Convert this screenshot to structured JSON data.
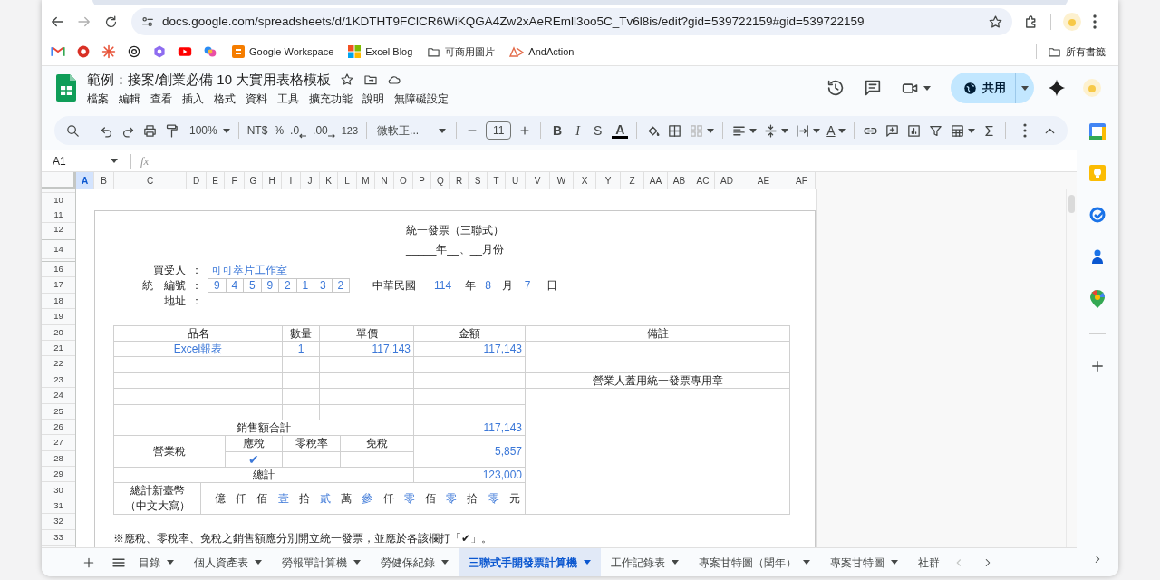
{
  "browser": {
    "url": "docs.google.com/spreadsheets/d/1KDTHT9FClCR6WiKQGA4Zw2xAeREmll3oo5C_Tv6l8is/edit?gid=539722159#gid=539722159",
    "bookmarks": [
      {
        "label": "Google Workspace",
        "kind": "site"
      },
      {
        "label": "Excel Blog",
        "kind": "windows"
      },
      {
        "label": "可商用圖片",
        "kind": "folder"
      },
      {
        "label": "AndAction",
        "kind": "triangle"
      }
    ],
    "all_bookmarks": "所有書籤"
  },
  "document": {
    "title": "範例：接案/創業必備 10 大實用表格模板",
    "menu": [
      "檔案",
      "編輯",
      "查看",
      "插入",
      "格式",
      "資料",
      "工具",
      "擴充功能",
      "說明",
      "無障礙設定"
    ],
    "share_label": "共用"
  },
  "toolbar": {
    "zoom": "100%",
    "currency": "NT$",
    "percent": "%",
    "decimal_decrease": ".0",
    "decimal_increase": ".00",
    "number_format": "123",
    "font": "微軟正...",
    "font_size": "11",
    "bold": "B",
    "italic": "I",
    "strikethrough": "S",
    "text_color": "A",
    "text_rotation": "A"
  },
  "formula_bar": {
    "name_box": "A1",
    "fx": "fx"
  },
  "columns": [
    {
      "label": "A",
      "selected": true
    },
    {
      "label": "B",
      "selected": false
    },
    {
      "label": "C",
      "selected": false
    },
    {
      "label": "D",
      "selected": false
    },
    {
      "label": "E",
      "selected": false
    },
    {
      "label": "F",
      "selected": false
    },
    {
      "label": "G",
      "selected": false
    },
    {
      "label": "H",
      "selected": false
    },
    {
      "label": "I",
      "selected": false
    },
    {
      "label": "J",
      "selected": false
    },
    {
      "label": "K",
      "selected": false
    },
    {
      "label": "L",
      "selected": false
    },
    {
      "label": "M",
      "selected": false
    },
    {
      "label": "N",
      "selected": false
    },
    {
      "label": "O",
      "selected": false
    },
    {
      "label": "P",
      "selected": false
    },
    {
      "label": "Q",
      "selected": false
    },
    {
      "label": "R",
      "selected": false
    },
    {
      "label": "S",
      "selected": false
    },
    {
      "label": "T",
      "selected": false
    },
    {
      "label": "U",
      "selected": false
    },
    {
      "label": "V",
      "selected": false
    },
    {
      "label": "W",
      "selected": false
    },
    {
      "label": "X",
      "selected": false
    },
    {
      "label": "Y",
      "selected": false
    },
    {
      "label": "Z",
      "selected": false
    },
    {
      "label": "AA",
      "selected": false
    },
    {
      "label": "AB",
      "selected": false
    },
    {
      "label": "AC",
      "selected": false
    },
    {
      "label": "AD",
      "selected": false
    },
    {
      "label": "AE",
      "selected": false
    },
    {
      "label": "AF",
      "selected": false
    }
  ],
  "rows": [
    "10",
    "11",
    "12",
    "14",
    "16",
    "17",
    "18",
    "19",
    "20",
    "21",
    "22",
    "23",
    "24",
    "25",
    "26",
    "27",
    "28",
    "29",
    "30",
    "31",
    "32",
    "33"
  ],
  "invoice": {
    "title": "統一發票（三聯式）",
    "period": "_____年__、__月份",
    "buyer": {
      "label": "買受人",
      "colon": "：",
      "value": "可可萃片工作室"
    },
    "tax_id": {
      "label": "統一編號",
      "colon": "：",
      "digits": [
        "9",
        "4",
        "5",
        "9",
        "2",
        "1",
        "3",
        "2"
      ]
    },
    "date": {
      "era": "中華民國",
      "year": "114",
      "year_unit": "年",
      "month": "8",
      "month_unit": "月",
      "day": "7",
      "day_unit": "日"
    },
    "address": {
      "label": "地址",
      "colon": "："
    },
    "headers": [
      "品名",
      "數量",
      "單價",
      "金額",
      "備註"
    ],
    "items": [
      {
        "name": "Excel報表",
        "quantity": "1",
        "unit_price": "117,143",
        "amount": "117,143"
      }
    ],
    "stamp_note": "營業人蓋用統一發票專用章",
    "subtotal": {
      "label": "銷售額合計",
      "value": "117,143"
    },
    "tax": {
      "label": "營業稅",
      "mark": "✔",
      "options": [
        {
          "label": "應稅",
          "checked": true
        },
        {
          "label": "零稅率",
          "checked": false
        },
        {
          "label": "免稅",
          "checked": false
        }
      ],
      "value": "5,857"
    },
    "total": {
      "label": "總計",
      "value": "123,000"
    },
    "in_words": {
      "label_lines": [
        "總計新臺幣",
        "（中文大寫）"
      ],
      "characters": [
        {
          "text": "億",
          "kind": "unit"
        },
        {
          "text": "仟",
          "kind": "unit"
        },
        {
          "text": "佰",
          "kind": "unit"
        },
        {
          "text": "壹",
          "kind": "digit"
        },
        {
          "text": "拾",
          "kind": "unit"
        },
        {
          "text": "貳",
          "kind": "digit"
        },
        {
          "text": "萬",
          "kind": "unit"
        },
        {
          "text": "參",
          "kind": "digit"
        },
        {
          "text": "仟",
          "kind": "unit"
        },
        {
          "text": "零",
          "kind": "digit"
        },
        {
          "text": "佰",
          "kind": "unit"
        },
        {
          "text": "零",
          "kind": "digit"
        },
        {
          "text": "拾",
          "kind": "unit"
        },
        {
          "text": "零",
          "kind": "digit"
        },
        {
          "text": "元",
          "kind": "unit"
        }
      ]
    },
    "footnote": "※應稅、零稅率、免稅之銷售額應分別開立統一發票，並應於各該欄打「✔」。"
  },
  "sheet_tabs": [
    {
      "label": "目錄",
      "selected": false
    },
    {
      "label": "個人資產表",
      "selected": false
    },
    {
      "label": "勞報單計算機",
      "selected": false
    },
    {
      "label": "勞健保紀錄",
      "selected": false
    },
    {
      "label": "三聯式手開發票計算機",
      "selected": true
    },
    {
      "label": "工作記錄表",
      "selected": false
    },
    {
      "label": "專案甘特圖（閏年）",
      "selected": false
    },
    {
      "label": "專案甘特圖",
      "selected": false
    },
    {
      "label": "社群",
      "selected": false
    }
  ]
}
